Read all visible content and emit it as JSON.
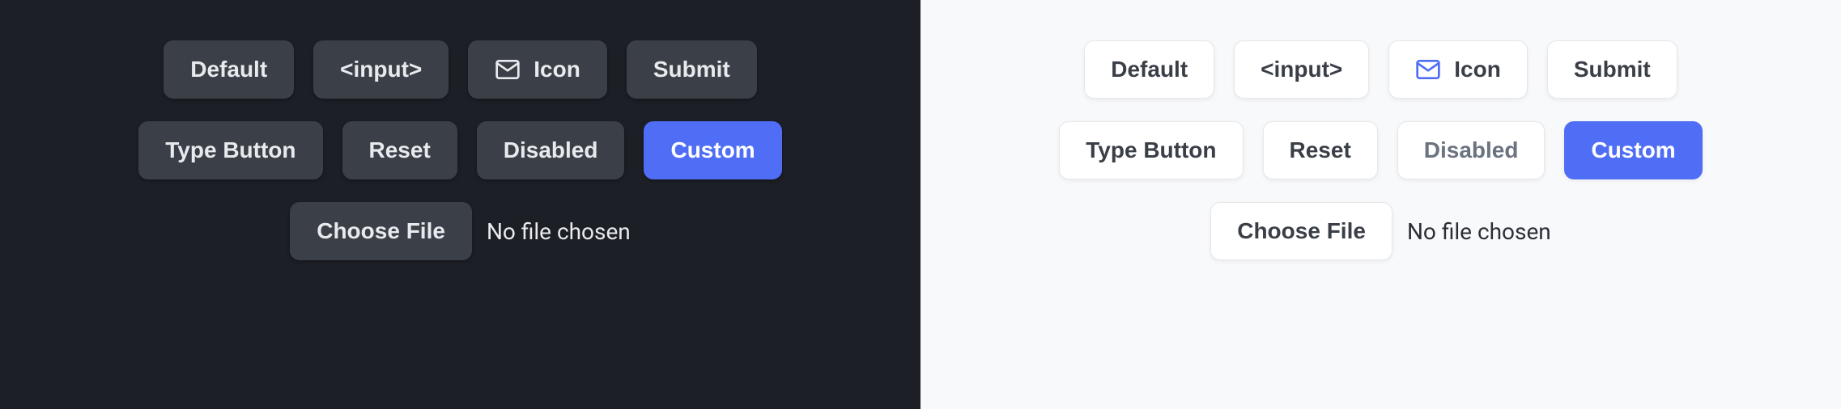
{
  "dark": {
    "row1": {
      "default": "Default",
      "input": "<input>",
      "icon": "Icon",
      "submit": "Submit"
    },
    "row2": {
      "type_button": "Type Button",
      "reset": "Reset",
      "disabled": "Disabled",
      "custom": "Custom"
    },
    "file": {
      "choose": "Choose File",
      "status": "No file chosen"
    }
  },
  "light": {
    "row1": {
      "default": "Default",
      "input": "<input>",
      "icon": "Icon",
      "submit": "Submit"
    },
    "row2": {
      "type_button": "Type Button",
      "reset": "Reset",
      "disabled": "Disabled",
      "custom": "Custom"
    },
    "file": {
      "choose": "Choose File",
      "status": "No file chosen"
    }
  },
  "colors": {
    "dark_bg": "#1c1f26",
    "dark_btn": "#3b4048",
    "light_bg": "#f8f9fb",
    "light_btn": "#ffffff",
    "accent": "#4f6ef5"
  }
}
